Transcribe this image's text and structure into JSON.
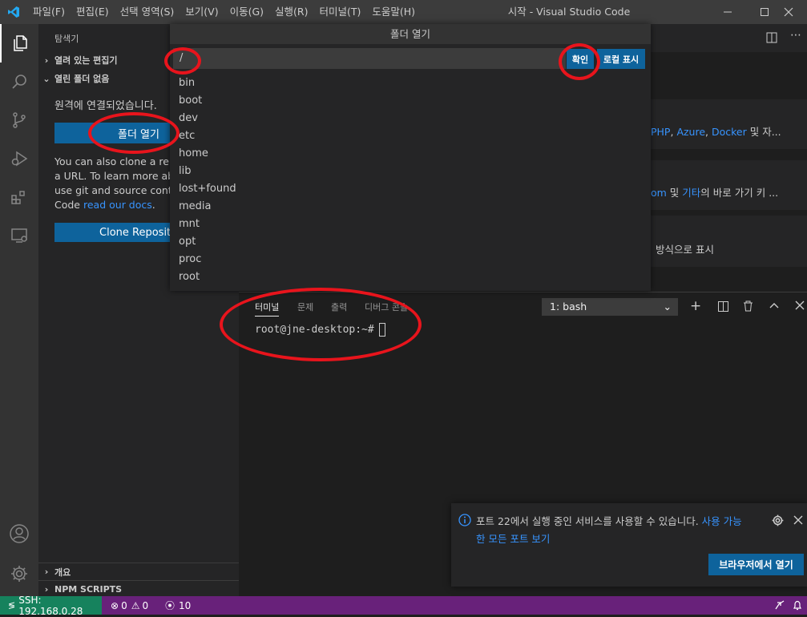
{
  "title_bar": {
    "menus": [
      "파일(F)",
      "편집(E)",
      "선택 영역(S)",
      "보기(V)",
      "이동(G)",
      "실행(R)",
      "터미널(T)",
      "도움말(H)"
    ],
    "window_title": "시작 - Visual Studio Code"
  },
  "activity_bar": {
    "icons": [
      "explorer-icon",
      "search-icon",
      "source-control-icon",
      "debug-icon",
      "extensions-icon",
      "remote-explorer-icon",
      "account-icon",
      "manage-gear-icon"
    ]
  },
  "sidebar": {
    "title": "탐색기",
    "open_editors": "열려 있는 편집기",
    "no_folder": "열린 폴더 없음",
    "connected_text": "원격에 연결되었습니다.",
    "open_folder_button": "폴더 열기",
    "clone_text_1": "You can also clone a repo",
    "clone_text_2": "a URL. To learn more abo",
    "clone_text_3": "use git and source contro",
    "clone_text_4": "Code",
    "clone_link": "read our docs",
    "clone_period": ".",
    "clone_button": "Clone Reposito",
    "outline": "개요",
    "npm_scripts": "NPM SCRIPTS"
  },
  "editor": {
    "card1_links": [
      "PHP",
      ", ",
      "Azure",
      ", ",
      "Docker"
    ],
    "card1_suffix": " 및 자...",
    "card2_link1": "om",
    "card2_mid": " 및 ",
    "card2_link2": "기타",
    "card2_suffix": "의 바로 가기 키 ...",
    "card3_text": "방식으로 표시"
  },
  "quick_pick": {
    "title": "폴더 열기",
    "input_value": "/",
    "ok_button": "확인",
    "local_button": "로컬 표시",
    "items": [
      "bin",
      "boot",
      "dev",
      "etc",
      "home",
      "lib",
      "lost+found",
      "media",
      "mnt",
      "opt",
      "proc",
      "root"
    ]
  },
  "panel": {
    "tabs": [
      "터미널",
      "문제",
      "출력",
      "디버그 콘솔"
    ],
    "terminal_select": "1: bash",
    "prompt": "root@jne-desktop:~#"
  },
  "notification": {
    "message_1": "포트 22에서 실행 중인 서비스를 사용할 수 있습니다. ",
    "message_link_1": "사용 가능",
    "message_link_2": "한 모든 포트 보기",
    "button": "브라우저에서 열기"
  },
  "status_bar": {
    "remote": "SSH: 192.168.0.28",
    "errors": "0",
    "warnings": "0",
    "ports": "10"
  },
  "colors": {
    "accent": "#0e639c",
    "status_bar": "#68217a",
    "remote_indicator": "#16825d",
    "annotation": "#e8141c",
    "link": "#3794ff"
  }
}
